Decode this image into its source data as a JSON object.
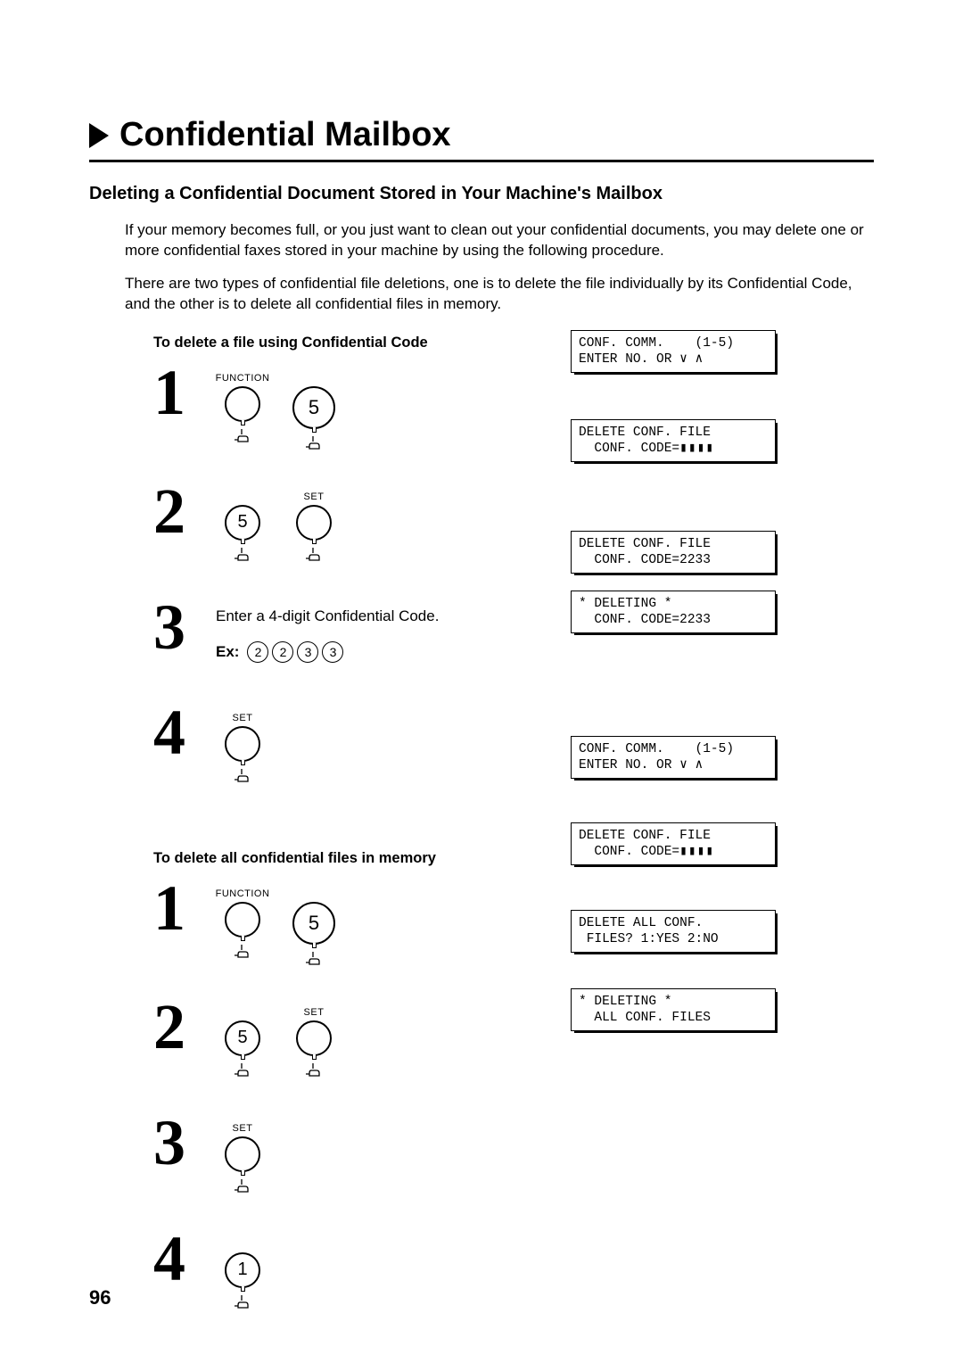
{
  "title": "Confidential Mailbox",
  "subheading": "Deleting a Confidential Document Stored in Your Machine's Mailbox",
  "intro1": "If your memory becomes full, or you just want to clean out your confidential documents, you may delete one or more confidential faxes stored in your machine by using the following procedure.",
  "intro2": "There are two types of confidential file deletions, one is to delete the file individually by its Confidential Code, and the other is to delete all confidential files in memory.",
  "procA": {
    "heading": "To delete a file using Confidential Code",
    "steps": {
      "1": {
        "btn1_label": "FUNCTION",
        "btn2_digit": "5"
      },
      "2": {
        "btn1_digit": "5",
        "btn2_label": "SET"
      },
      "3": {
        "text": "Enter a 4-digit Confidential Code.",
        "ex_label": "Ex:",
        "digits": [
          "2",
          "2",
          "3",
          "3"
        ]
      },
      "4": {
        "btn_label": "SET"
      }
    },
    "lcd": {
      "1a": "CONF. COMM.    (1-5)",
      "1b": "ENTER NO. OR ∨ ∧",
      "2a": "DELETE CONF. FILE",
      "2b": "  CONF. CODE=",
      "3a": "DELETE CONF. FILE",
      "3b": "  CONF. CODE=2233",
      "4a": "* DELETING *",
      "4b": "  CONF. CODE=2233"
    }
  },
  "procB": {
    "heading": "To delete all confidential files in memory",
    "steps": {
      "1": {
        "btn1_label": "FUNCTION",
        "btn2_digit": "5"
      },
      "2": {
        "btn1_digit": "5",
        "btn2_label": "SET"
      },
      "3": {
        "btn_label": "SET"
      },
      "4": {
        "btn_digit": "1"
      }
    },
    "lcd": {
      "1a": "CONF. COMM.    (1-5)",
      "1b": "ENTER NO. OR ∨ ∧",
      "2a": "DELETE CONF. FILE",
      "2b": "  CONF. CODE=",
      "3a": "DELETE ALL CONF.",
      "3b": " FILES? 1:YES 2:NO",
      "4a": "* DELETING *",
      "4b": "  ALL CONF. FILES"
    }
  },
  "page_number": "96"
}
